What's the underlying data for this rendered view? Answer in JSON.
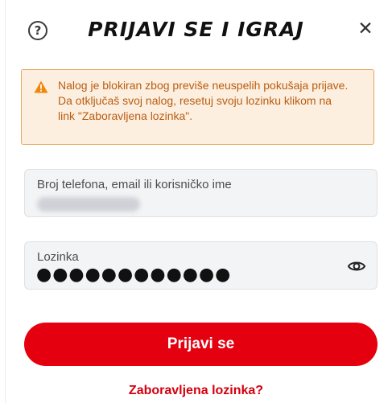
{
  "header": {
    "title": "PRIJAVI SE I IGRAJ",
    "help_glyph": "?",
    "close_glyph": "✕",
    "icons": [
      "help-icon",
      "close-icon"
    ]
  },
  "alert": {
    "icon": "warning-icon",
    "color": "#b85c10",
    "lines": [
      "Nalog je blokiran zbog previše neuspelih pokušaja prijave.",
      "Da otključaš svoj nalog, resetuj svoju lozinku klikom na",
      "link \"Zaboravljena lozinka\"."
    ]
  },
  "form": {
    "username": {
      "label": "Broj telefona, email ili korisničko ime"
    },
    "password": {
      "label": "Lozinka",
      "masked_value": "●●●●●●●●●●●●",
      "toggle_icon": "eye-icon"
    },
    "submit_label": "Prijavi se",
    "forgot_label": "Zaboravljena lozinka?"
  },
  "colors": {
    "accent": "#e4000f",
    "alert_bg": "#fdefe0",
    "alert_border": "#e8a65e"
  }
}
